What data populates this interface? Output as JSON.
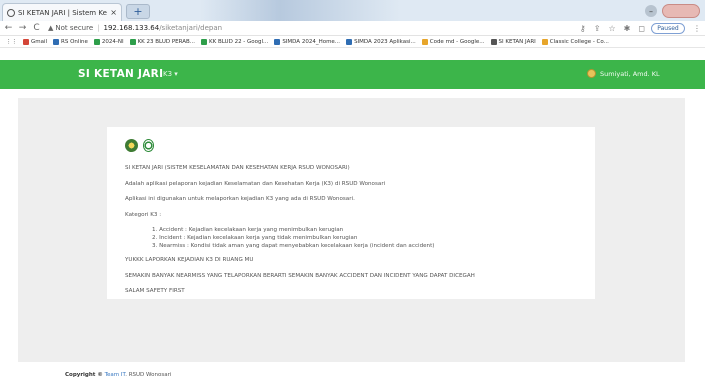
{
  "browser": {
    "tab_title": "SI KETAN JARI | Sistem Keselama",
    "tab_close": "×",
    "new_tab": "+",
    "address_warning": "Not secure",
    "address_host": "192.168.133.64",
    "address_path": "/siketanjari/depan",
    "paused_label": "Paused",
    "profile_label": "",
    "bookmarks": [
      {
        "label": "Gmail",
        "color": "#d44638"
      },
      {
        "label": "RS Online",
        "color": "#2f6db3"
      },
      {
        "label": "2024-NI",
        "color": "#2e9e4a"
      },
      {
        "label": "KK 23 BLUD PERAB...",
        "color": "#2e9e4a"
      },
      {
        "label": "KK BLUD 22 - Googl...",
        "color": "#2e9e4a"
      },
      {
        "label": "SIMDA 2024_Home...",
        "color": "#2f6db3"
      },
      {
        "label": "SIMDA 2023 Aplikasi...",
        "color": "#2f6db3"
      },
      {
        "label": "Code md - Google...",
        "color": "#e7a52a"
      },
      {
        "label": "SI KETAN JARI",
        "color": "#555555"
      },
      {
        "label": "Classic College - Co...",
        "color": "#e7a52a"
      }
    ]
  },
  "app": {
    "brand": "SI KETAN JARI",
    "menu_label": "K3 ▾",
    "user_name": "Sumiyati, Amd. KL",
    "accent_color": "#3cb54a"
  },
  "card": {
    "paragraphs": [
      "SI KETAN JARI (SISTEM KESELAMATAN DAN KESEHATAN KERJA RSUD WONOSARI)",
      "Adalah aplikasi pelaporan kejadian Keselamatan dan Kesehatan Kerja (K3) di RSUD Wonosari",
      "Aplikasi ini digunakan untuk melaporkan kejadian K3 yang ada di RSUD Wonosari.",
      "Kategori K3 :"
    ],
    "categories": [
      "1. Accident : Kejadian kecelakaan kerja yang menimbulkan kerugian",
      "2. Incident : Kejadian kecelakaan kerja yang tidak menimbulkan kerugian",
      "3. Nearmiss : Kondisi tidak aman yang dapat menyebabkan kecelakaan kerja (incident dan accident)"
    ],
    "closing": [
      "YUKKK LAPORKAN KEJADIAN K3 DI RUANG MU",
      "SEMAKIN BANYAK NEARMISS YANG TELAPORKAN BERARTI SEMAKIN BANYAK ACCIDENT DAN INCIDENT YANG DAPAT DICEGAH",
      "SALAM SAFETY FIRST"
    ]
  },
  "footer": {
    "prefix": "Copyright ©",
    "team": "Team IT",
    "org": ". RSUD Wonosari"
  }
}
